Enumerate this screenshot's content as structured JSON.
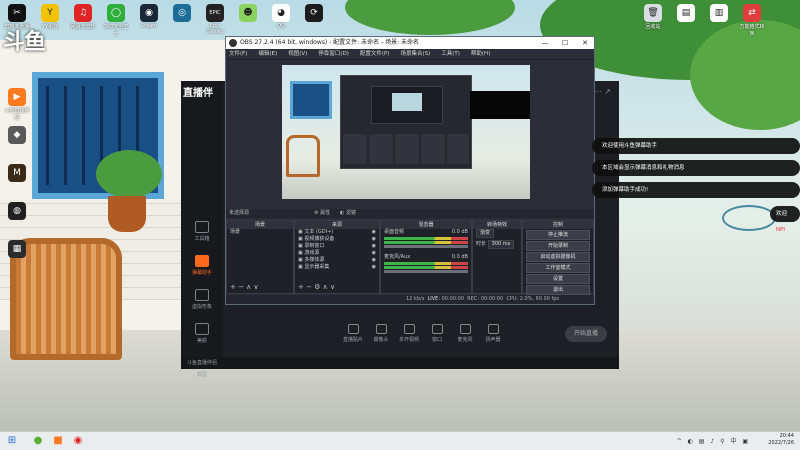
{
  "desktop": {
    "brand_text": "斗鱼",
    "icons_top": [
      {
        "label": "剪映专业版",
        "glyph": "✂",
        "color": "#111111"
      },
      {
        "label": "YY语音",
        "glyph": "Y",
        "color": "#f3c200"
      },
      {
        "label": "网易云音乐",
        "glyph": "♫",
        "color": "#e02424"
      },
      {
        "label": "360安全卫士",
        "glyph": "◯",
        "color": "#2fae3b"
      },
      {
        "label": "Steam",
        "glyph": "◉",
        "color": "#1b2838"
      },
      {
        "label": "",
        "glyph": "◎",
        "color": "#1c6e97"
      },
      {
        "label": "Epic Games",
        "glyph": "EPIC",
        "color": "#222222"
      },
      {
        "label": "",
        "glyph": "☻",
        "color": "#8ad35f"
      },
      {
        "label": "QQ",
        "glyph": "◕",
        "color": "#ffffff"
      },
      {
        "label": "",
        "glyph": "⟳",
        "color": "#1c1c1c"
      }
    ],
    "icons_left": [
      {
        "label": "斗鱼直播伴侣",
        "glyph": "▶",
        "color": "#ff7a1f"
      },
      {
        "label": "",
        "glyph": "◆",
        "color": "#5a5a5a"
      },
      {
        "label": "",
        "glyph": "M",
        "color": "#3b2a18"
      },
      {
        "label": "",
        "glyph": "◍",
        "color": "#202020"
      },
      {
        "label": "",
        "glyph": "▦",
        "color": "#2b2b2b"
      }
    ],
    "icons_right": [
      {
        "label": "回收站",
        "glyph": "🗑",
        "color": "#d7dde2"
      },
      {
        "label": "",
        "glyph": "▤",
        "color": "#ffffff"
      },
      {
        "label": "",
        "glyph": "▥",
        "color": "#ffffff"
      },
      {
        "label": "万能格式转换",
        "glyph": "⇄",
        "color": "#e23c3c"
      }
    ]
  },
  "helper": {
    "logo": "直播伴",
    "side_items": [
      "工具箱",
      "弹幕助手",
      "虚拟形象",
      "美颜",
      "截图"
    ],
    "active_index": 1,
    "actions": [
      "直播贴片",
      "摄像头",
      "多开视频",
      "窗口",
      "麦克风",
      "扬声器"
    ],
    "start_label": "开始直播",
    "status_left": "斗鱼直播伴侣",
    "top_icons": "⋯  ↗"
  },
  "obs": {
    "title": "OBS 27.2.4 (64 bit, windows) - 配置文件: 未命名 - 场景: 未命名",
    "menu": [
      "文件(F)",
      "编辑(E)",
      "视图(V)",
      "停靠窗口(D)",
      "配置文件(P)",
      "场景集合(S)",
      "工具(T)",
      "帮助(H)"
    ],
    "no_source": "未选择源",
    "properties_label": "属性",
    "filters_label": "滤镜",
    "docks": {
      "scenes": {
        "title": "场景",
        "items": [
          "场景"
        ]
      },
      "sources": {
        "title": "来源",
        "items": [
          "文本 (GDI+)",
          "视频捕获设备",
          "录制窗口",
          "游戏源",
          "多媒体源",
          "显示器采集"
        ]
      },
      "mixer": {
        "title": "混音器",
        "ch1": "桌面音频",
        "ch2": "麦克风/Aux",
        "db1": "0.0 dB",
        "db2": "0.0 dB"
      },
      "transitions": {
        "title": "转场特效",
        "type": "渐变",
        "duration_label": "时长",
        "duration_value": "300 ms"
      },
      "controls": {
        "title": "控制",
        "buttons": [
          "停止推流",
          "开始录制",
          "启动虚拟摄像机",
          "工作室模式",
          "设置",
          "退出"
        ]
      }
    },
    "status": {
      "live_label": "LIVE:",
      "live_time": "00:00:00",
      "rec_label": "REC:",
      "rec_time": "00:00:00",
      "cpu": "CPU: 2.0%, 60.00 fps",
      "bitrate": "12 kb/s"
    }
  },
  "chat": [
    {
      "text": "欢迎使用斗鱼弹幕助手"
    },
    {
      "text": "本区域会显示弹幕消息和礼物消息"
    },
    {
      "text": "添加弹幕助手成功!"
    }
  ],
  "chat_partial": {
    "text": "欢迎",
    "highlight": "NPI"
  },
  "taskbar": {
    "apps": [
      {
        "glyph": "⊞",
        "color": "#2a6fd6"
      },
      {
        "glyph": "●",
        "color": "#5ab035"
      },
      {
        "glyph": "■",
        "color": "#ff7a1f"
      },
      {
        "glyph": "◉",
        "color": "#e02424"
      }
    ],
    "tray_icons": "^ ◐ ▤ ♪ ⚲ 中 ▣",
    "time": "20:44",
    "date": "2022/7/26"
  }
}
